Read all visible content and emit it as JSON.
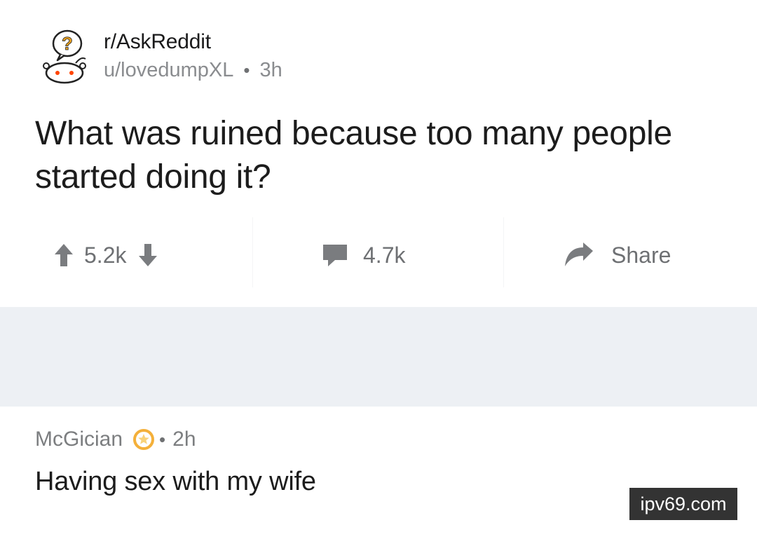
{
  "post": {
    "subreddit": "r/AskReddit",
    "author": "u/lovedumpXL",
    "separator": "•",
    "age": "3h",
    "title": "What was ruined because too many people started doing it?",
    "avatar_icon": "question-alien-icon"
  },
  "actions": {
    "votes": "5.2k",
    "comments": "4.7k",
    "share": "Share",
    "upvote_icon": "arrow-up-icon",
    "downvote_icon": "arrow-down-icon",
    "comment_icon": "comment-bubble-icon",
    "share_icon": "share-arrow-icon"
  },
  "comment": {
    "author": "McGician",
    "separator": "•",
    "age": "2h",
    "body": "Having sex with my wife",
    "badge_icon": "award-icon",
    "badge_color": "#f4b03a"
  },
  "watermark": {
    "text": "ipv69.com"
  },
  "colors": {
    "band": "#edf0f4",
    "muted": "#7c7e80",
    "text": "#1c1c1c"
  }
}
